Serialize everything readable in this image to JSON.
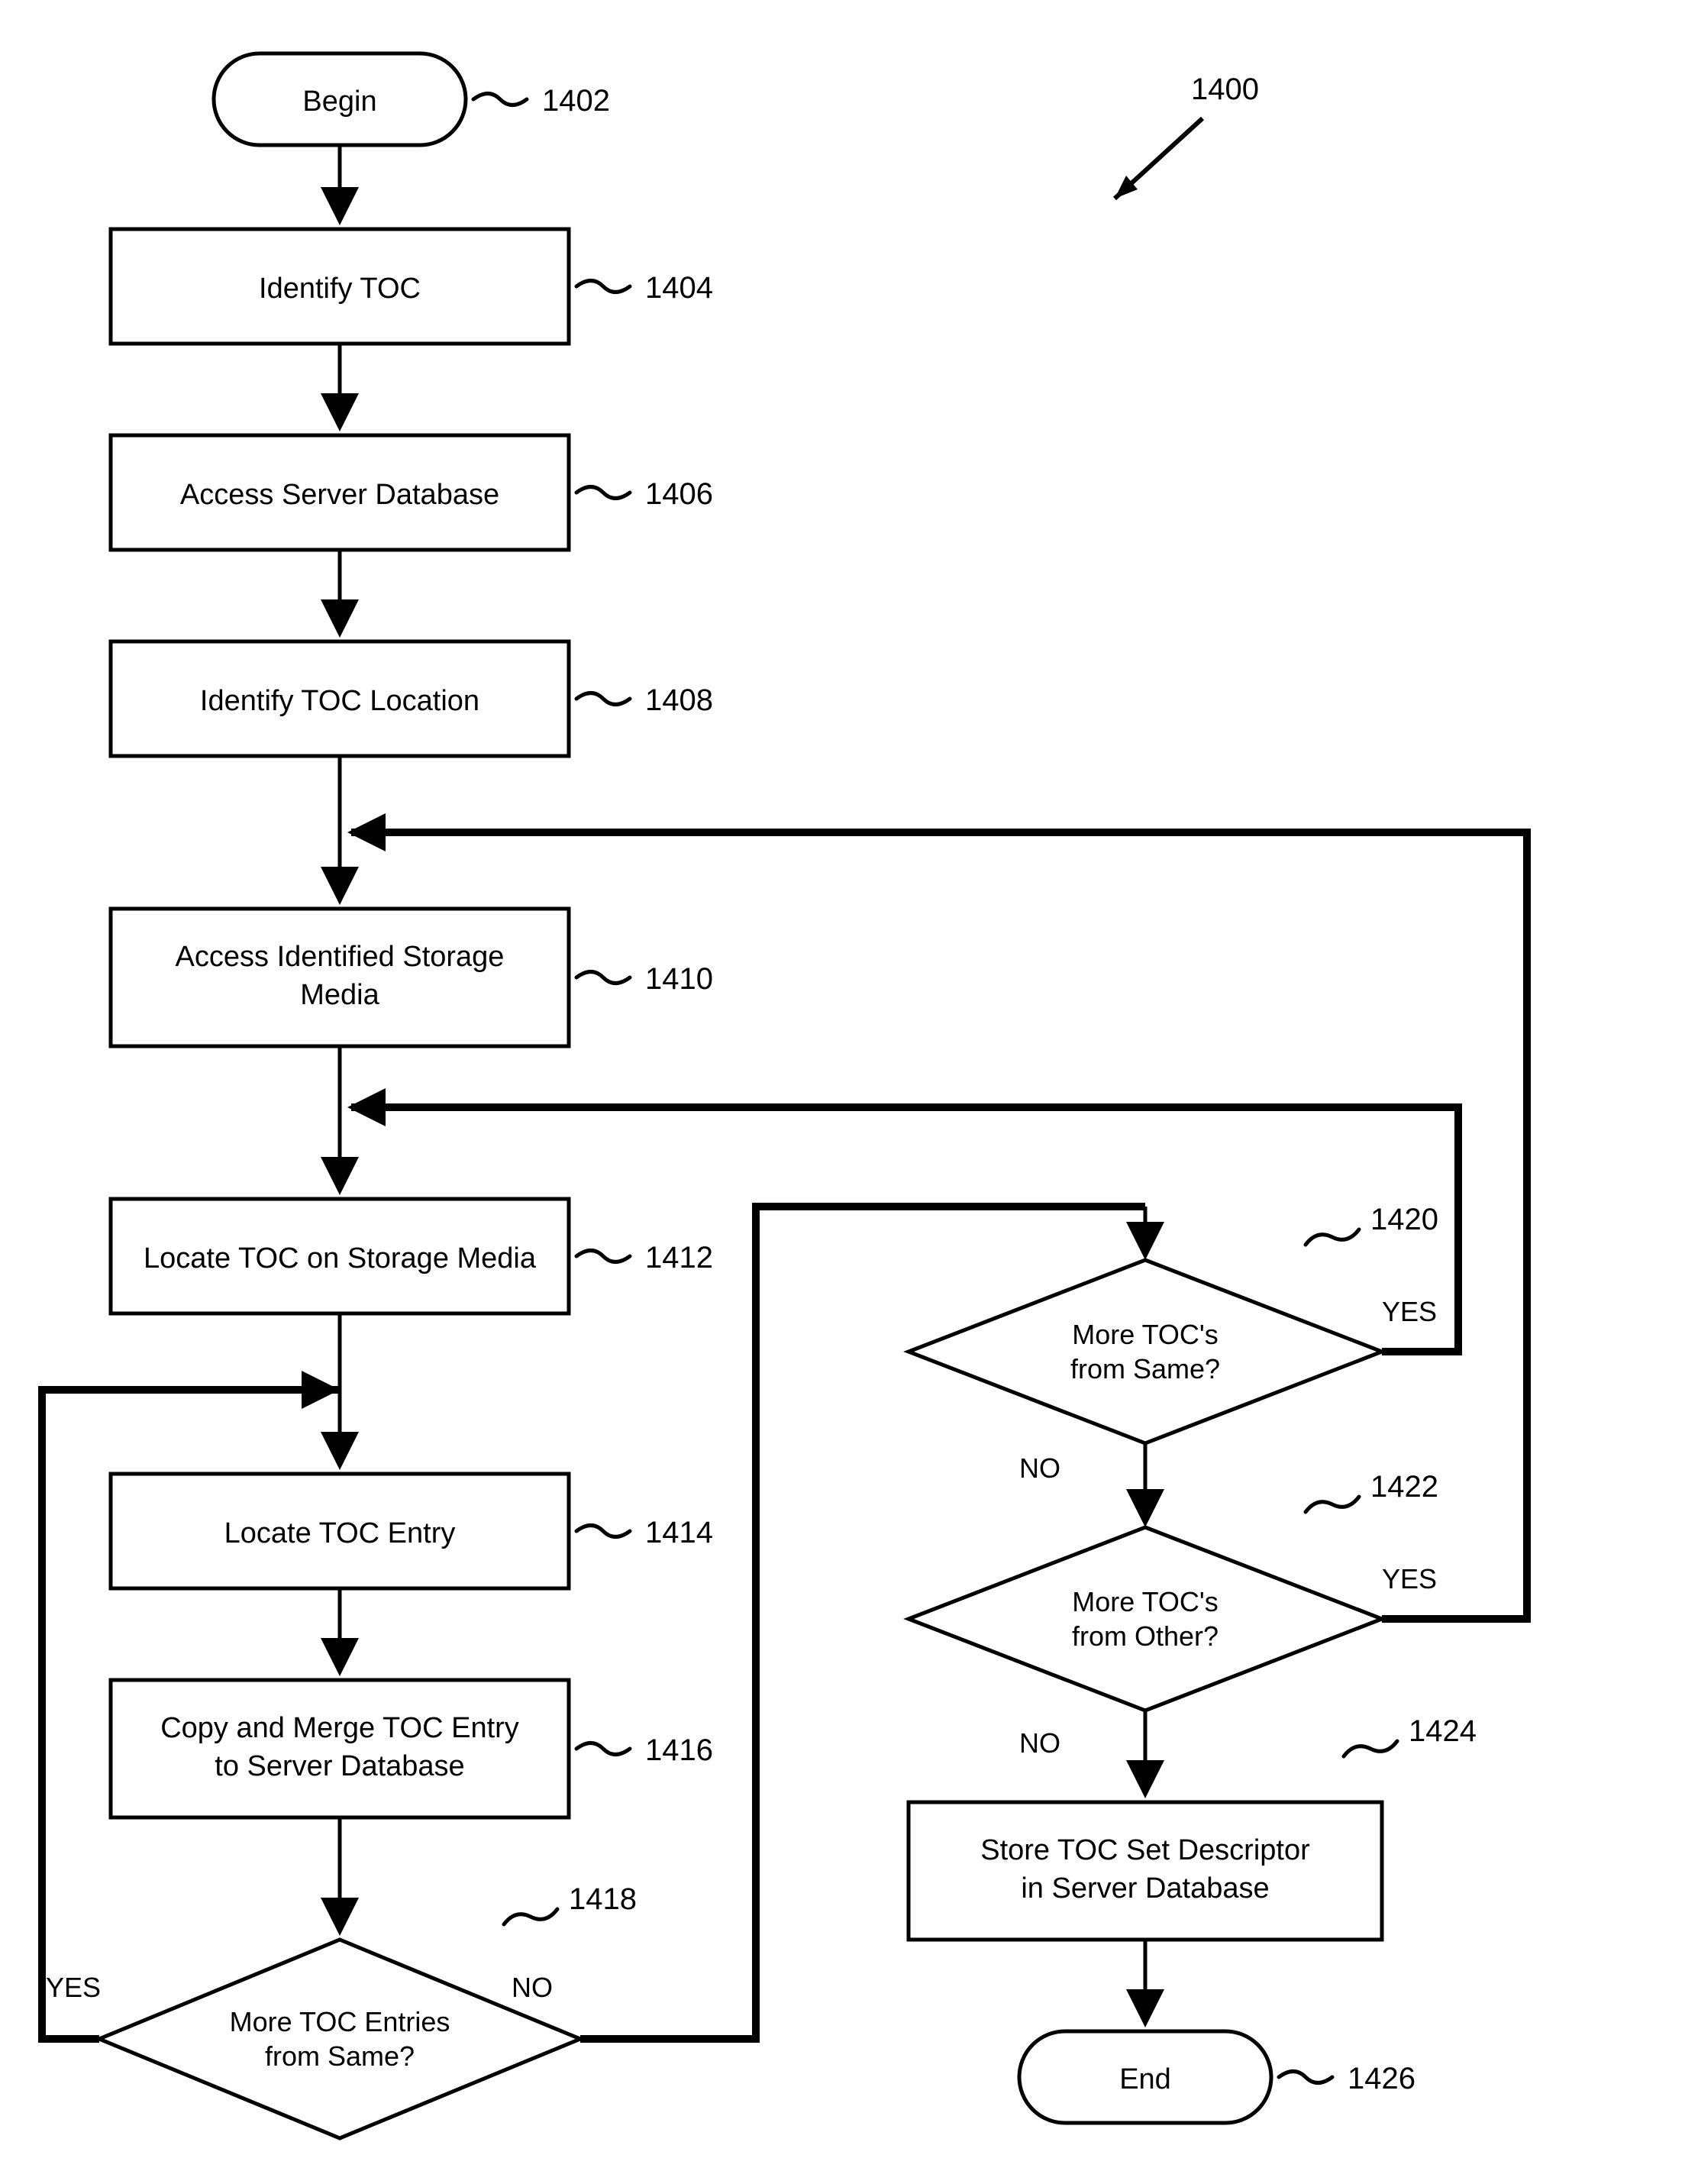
{
  "diagram_label": "1400",
  "nodes": {
    "begin": {
      "text": "Begin",
      "label": "1402"
    },
    "n1404": {
      "text": "Identify TOC",
      "label": "1404"
    },
    "n1406": {
      "text": "Access Server Database",
      "label": "1406"
    },
    "n1408": {
      "text": "Identify TOC Location",
      "label": "1408"
    },
    "n1410": {
      "line1": "Access Identified Storage",
      "line2": "Media",
      "label": "1410"
    },
    "n1412": {
      "text": "Locate TOC on Storage Media",
      "label": "1412"
    },
    "n1414": {
      "text": "Locate TOC Entry",
      "label": "1414"
    },
    "n1416": {
      "line1": "Copy and Merge TOC Entry",
      "line2": "to Server Database",
      "label": "1416"
    },
    "d1418": {
      "line1": "More TOC Entries",
      "line2": "from Same?",
      "label": "1418"
    },
    "d1420": {
      "line1": "More TOC's",
      "line2": "from Same?",
      "label": "1420"
    },
    "d1422": {
      "line1": "More TOC's",
      "line2": "from Other?",
      "label": "1422"
    },
    "n1424": {
      "line1": "Store TOC Set Descriptor",
      "line2": "in Server Database",
      "label": "1424"
    },
    "end": {
      "text": "End",
      "label": "1426"
    }
  },
  "edges": {
    "yes": "YES",
    "no": "NO"
  }
}
